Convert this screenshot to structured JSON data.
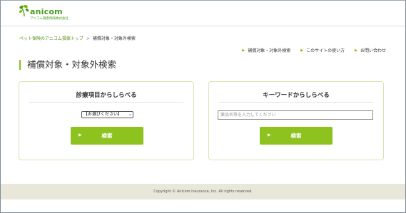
{
  "brand": {
    "name": "anicom",
    "company": "アニコム損害保険株式会社",
    "brand_color": "#4a9c1f",
    "accent_color": "#8dc21f"
  },
  "breadcrumb": {
    "home": "ペット保険のアニコム損保トップ",
    "separator": ">",
    "current": "補償対象・対象外検索"
  },
  "topnav": {
    "items": [
      {
        "label": "補償対象・対象外検索",
        "icon": "triangle-right-icon"
      },
      {
        "label": "このサイトの使い方",
        "icon": "triangle-right-icon"
      },
      {
        "label": "お問い合わせ",
        "icon": "triangle-right-icon"
      }
    ]
  },
  "page": {
    "title": "補償対象・対象外検索"
  },
  "category_search": {
    "title": "診療項目からしらべる",
    "select_value": "【お選びください】",
    "button_label": "検索"
  },
  "keyword_search": {
    "title": "キーワードからしらべる",
    "placeholder": "薬品名等を入力してください",
    "button_label": "検索"
  },
  "footer": {
    "copyright": "Copyright © Anicom Insurance, Inc. All rights reserved."
  }
}
